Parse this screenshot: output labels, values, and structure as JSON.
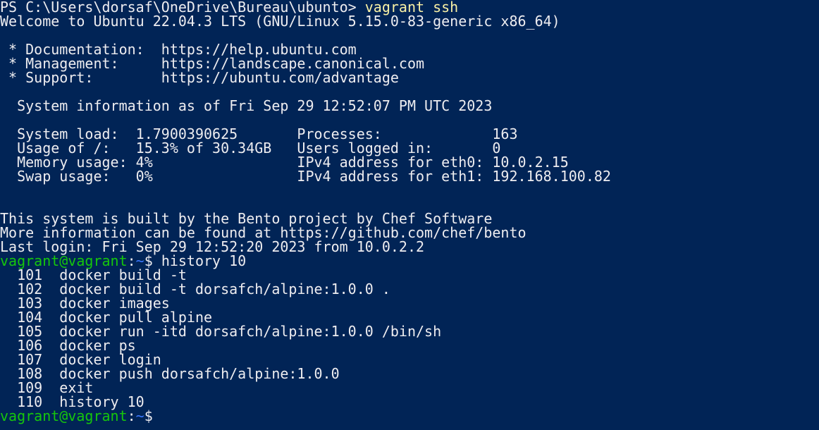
{
  "theme": {
    "background": "#012456",
    "foreground": "#eeedf0",
    "command_color": "#f9f1a5",
    "prompt_user_color": "#16c60c",
    "prompt_path_color": "#3b78ff"
  },
  "ps_prompt": {
    "prefix": "PS C:\\Users\\dorsaf\\OneDrive\\Bureau\\ubunto> ",
    "command": "vagrant ssh"
  },
  "motd": {
    "welcome": "Welcome to Ubuntu 22.04.3 LTS (GNU/Linux 5.15.0-83-generic x86_64)",
    "blank1": "",
    "doc": " * Documentation:  https://help.ubuntu.com",
    "management": " * Management:     https://landscape.canonical.com",
    "support": " * Support:        https://ubuntu.com/advantage",
    "blank2": "",
    "sysinfo_header": "  System information as of Fri Sep 29 12:52:07 PM UTC 2023",
    "blank3": "",
    "stats": [
      "  System load:  1.7900390625       Processes:             163",
      "  Usage of /:   15.3% of 30.34GB   Users logged in:       0",
      "  Memory usage: 4%                 IPv4 address for eth0: 10.0.2.15",
      "  Swap usage:   0%                 IPv4 address for eth1: 192.168.100.82"
    ],
    "blank4": "",
    "blank5": "",
    "bento1": "This system is built by the Bento project by Chef Software",
    "bento2": "More information can be found at https://github.com/chef/bento",
    "last_login": "Last login: Fri Sep 29 12:52:20 2023 from 10.0.2.2"
  },
  "shell_prompt": {
    "user_host": "vagrant@vagrant",
    "separator": ":",
    "path": "~",
    "symbol": "$ ",
    "command": "history 10"
  },
  "history": [
    "  101  docker build -t",
    "  102  docker build -t dorsafch/alpine:1.0.0 .",
    "  103  docker images",
    "  104  docker pull alpine",
    "  105  docker run -itd dorsafch/alpine:1.0.0 /bin/sh",
    "  106  docker ps",
    "  107  docker login",
    "  108  docker push dorsafch/alpine:1.0.0",
    "  109  exit",
    "  110  history 10"
  ],
  "final_prompt": {
    "user_host": "vagrant@vagrant",
    "separator": ":",
    "path": "~",
    "symbol": "$"
  }
}
